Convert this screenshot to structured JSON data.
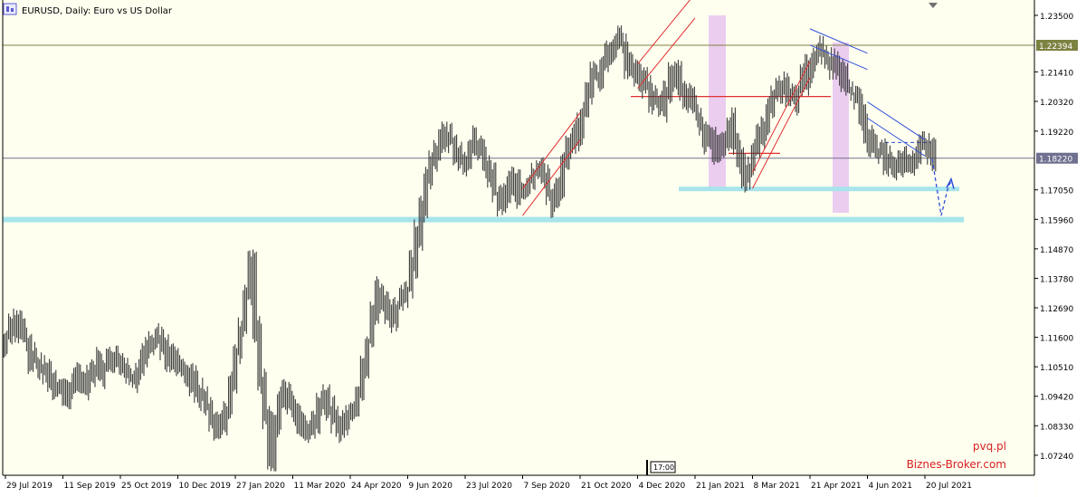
{
  "header": {
    "title": "EURUSD, Daily:  Euro vs US Dollar"
  },
  "price_tags": {
    "upper": "1.22394",
    "current": "1.18220"
  },
  "server_time_label": "17:00",
  "watermarks": {
    "site1": "pvq.pl",
    "site2": "Biznes-Broker.com"
  },
  "colors": {
    "background": "#fffff0",
    "candles": "#3a3a3a",
    "support_zone": "#a8e4ec",
    "highlight_band": "#e9c8ef",
    "channel_red": "#e03030",
    "channel_blue": "#3050d8",
    "watermark": "#d82020",
    "level_upper": "#7c8240",
    "level_current": "#707090"
  },
  "chart_data": {
    "type": "candlestick",
    "symbol": "EURUSD",
    "timeframe": "Daily",
    "ylim": [
      1.065,
      1.24
    ],
    "grid": false,
    "y_ticks": [
      "1.23500",
      "1.22394",
      "1.21410",
      "1.20320",
      "1.19220",
      "1.18220",
      "1.17050",
      "1.15960",
      "1.14870",
      "1.13780",
      "1.12690",
      "1.11600",
      "1.10510",
      "1.09420",
      "1.08330",
      "1.07240"
    ],
    "x_ticks": [
      "29 Jul 2019",
      "11 Sep 2019",
      "25 Oct 2019",
      "10 Dec 2019",
      "27 Jan 2020",
      "11 Mar 2020",
      "24 Apr 2020",
      "9 Jun 2020",
      "23 Jul 2020",
      "7 Sep 2020",
      "21 Oct 2020",
      "4 Dec 2020",
      "21 Jan 2021",
      "8 Mar 2021",
      "21 Apr 2021",
      "4 Jun 2021",
      "20 Jul 2021"
    ],
    "series_close": [
      1.1155,
      1.12,
      1.1235,
      1.119,
      1.114,
      1.1085,
      1.107,
      1.105,
      1.103,
      1.1,
      1.098,
      1.096,
      1.0935,
      1.096,
      1.0995,
      1.1005,
      1.0975,
      1.102,
      1.106,
      1.103,
      1.1065,
      1.109,
      1.11,
      1.107,
      1.1045,
      1.102,
      1.1005,
      1.105,
      1.109,
      1.113,
      1.116,
      1.115,
      1.112,
      1.108,
      1.106,
      1.1045,
      1.103,
      1.102,
      1.1,
      1.097,
      1.094,
      1.09,
      1.086,
      1.0835,
      1.0845,
      1.09,
      1.1,
      1.112,
      1.12,
      1.132,
      1.144,
      1.12,
      1.1,
      1.086,
      1.072,
      1.084,
      1.093,
      1.096,
      1.09,
      1.088,
      1.084,
      1.08,
      1.082,
      1.086,
      1.092,
      1.095,
      1.088,
      1.0845,
      1.083,
      1.086,
      1.088,
      1.089,
      1.096,
      1.105,
      1.115,
      1.125,
      1.133,
      1.13,
      1.127,
      1.123,
      1.128,
      1.132,
      1.135,
      1.143,
      1.153,
      1.164,
      1.175,
      1.181,
      1.186,
      1.189,
      1.192,
      1.188,
      1.183,
      1.181,
      1.179,
      1.185,
      1.188,
      1.184,
      1.18,
      1.176,
      1.169,
      1.164,
      1.168,
      1.172,
      1.174,
      1.17,
      1.171,
      1.174,
      1.177,
      1.179,
      1.175,
      1.17,
      1.165,
      1.17,
      1.18,
      1.185,
      1.188,
      1.193,
      1.198,
      1.207,
      1.214,
      1.212,
      1.218,
      1.22,
      1.224,
      1.227,
      1.225,
      1.218,
      1.214,
      1.212,
      1.21,
      1.208,
      1.205,
      1.204,
      1.201,
      1.206,
      1.212,
      1.215,
      1.208,
      1.205,
      1.202,
      1.199,
      1.194,
      1.19,
      1.192,
      1.185,
      1.188,
      1.191,
      1.195,
      1.186,
      1.18,
      1.174,
      1.178,
      1.185,
      1.19,
      1.195,
      1.2,
      1.205,
      1.207,
      1.208,
      1.206,
      1.204,
      1.208,
      1.211,
      1.215,
      1.218,
      1.22,
      1.222,
      1.219,
      1.217,
      1.214,
      1.211,
      1.208,
      1.206,
      1.203,
      1.196,
      1.19,
      1.188,
      1.186,
      1.185,
      1.182,
      1.179,
      1.178,
      1.18,
      1.177,
      1.179,
      1.183,
      1.186,
      1.187,
      1.185,
      1.182
    ],
    "channels": [
      {
        "color": "red",
        "from": [
          "7 Sep 2020",
          1.161
        ],
        "to": [
          "21 Oct 2020",
          1.189
        ],
        "width": 0.01
      },
      {
        "color": "red",
        "from": [
          "4 Dec 2020",
          1.208
        ],
        "to": [
          "21 Jan 2021",
          1.234
        ],
        "width": 0.009
      },
      {
        "color": "red",
        "from": [
          "8 Mar 2021",
          1.171
        ],
        "to": [
          "21 Apr 2021",
          1.212
        ],
        "width": 0.006
      },
      {
        "color": "blue",
        "from": [
          "21 Apr 2021",
          1.224
        ],
        "to": [
          "4 Jun 2021",
          1.215
        ],
        "width": 0.006
      },
      {
        "color": "blue",
        "from": [
          "4 Jun 2021",
          1.197
        ],
        "to": [
          "20 Jul 2021",
          1.183
        ],
        "width": 0.006
      }
    ]
  }
}
